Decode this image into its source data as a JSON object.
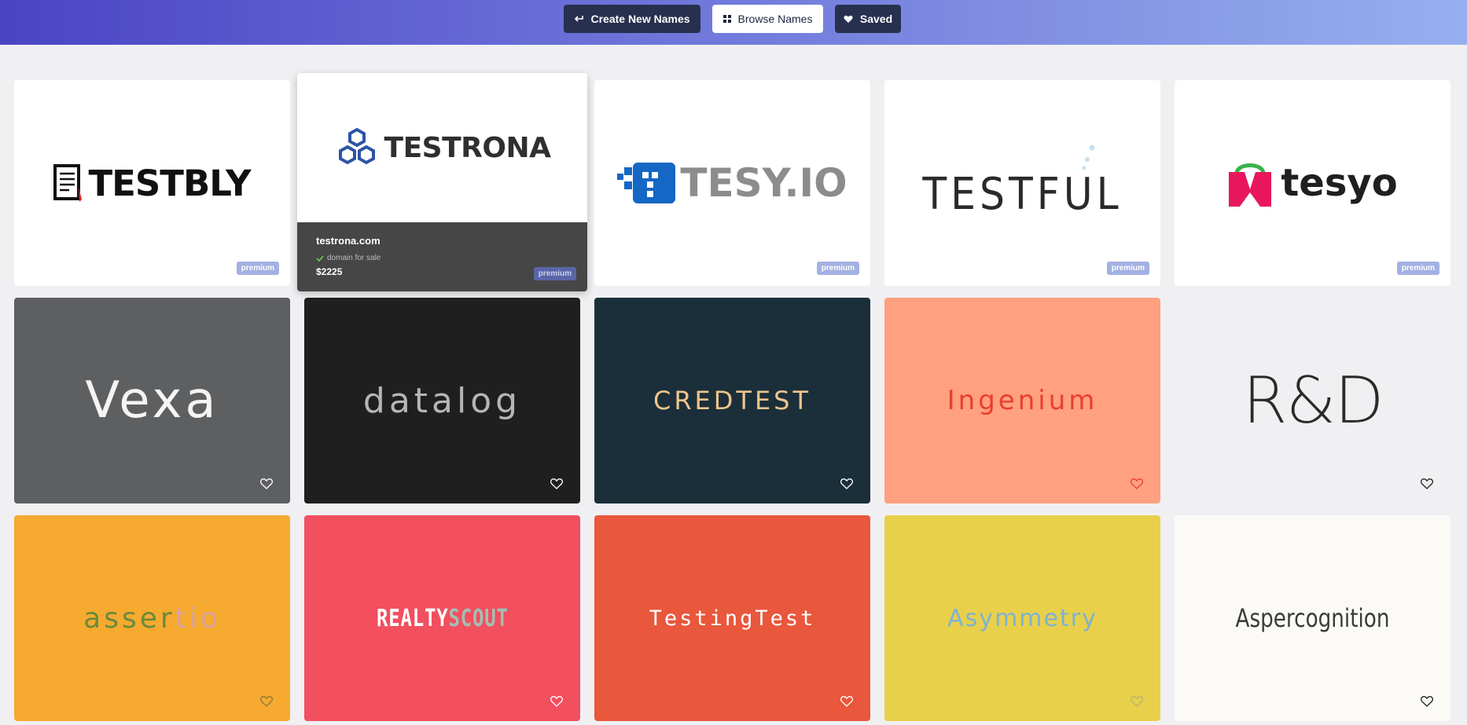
{
  "nav": {
    "create_label": "Create New Names",
    "browse_label": "Browse Names",
    "saved_label": "Saved"
  },
  "cards": [
    {
      "id": "testbly",
      "wordmark": "TESTBLY",
      "badge": "premium",
      "bg": "#ffffff"
    },
    {
      "id": "testrona",
      "wordmark": "TESTRONA",
      "badge": "premium",
      "bg": "#ffffff",
      "domain": "testrona.com",
      "status": "domain for sale",
      "price": "$2225"
    },
    {
      "id": "tesy",
      "wordmark": "TESY.IO",
      "badge": "premium",
      "bg": "#ffffff"
    },
    {
      "id": "testful",
      "wordmark": "TESTFUL",
      "badge": "premium",
      "bg": "#ffffff"
    },
    {
      "id": "tesyo",
      "wordmark": "tesyo",
      "badge": "premium",
      "bg": "#ffffff"
    },
    {
      "id": "vexa",
      "wordmark": "Vexa",
      "bg": "#5d5f61",
      "heart": "#ffffff"
    },
    {
      "id": "datalog",
      "wordmark": "datalog",
      "bg": "#1f1f1f",
      "heart": "#ffffff"
    },
    {
      "id": "credtest",
      "wordmark": "CREDTEST",
      "bg": "#1b2f3a",
      "heart": "#ffffff"
    },
    {
      "id": "ingenium",
      "wordmark": "Ingenium",
      "bg": "#ffa080",
      "heart": "#e8402e"
    },
    {
      "id": "rd",
      "wordmark": "R&D",
      "bg": "#f0f0f3",
      "heart": "#222222"
    },
    {
      "id": "assertio",
      "wordmark": "asser",
      "wordmark_tail": "tio",
      "bg": "#f6aa2f",
      "heart": "#8a7b3c"
    },
    {
      "id": "realtyscout",
      "wordmark": "REALTY",
      "wordmark_tail": "SCOUT",
      "bg": "#f24f5f",
      "heart": "#ffffff"
    },
    {
      "id": "testingtest",
      "wordmark": "TestingTest",
      "bg": "#e9573c",
      "heart": "#ffffff"
    },
    {
      "id": "asymmetry",
      "wordmark": "Asymmetry",
      "bg": "#e8d04b",
      "heart": "#b7b368"
    },
    {
      "id": "aspercognition",
      "wordmark": "Aspercognition",
      "bg": "#fbfaf7",
      "heart": "#222222"
    }
  ]
}
